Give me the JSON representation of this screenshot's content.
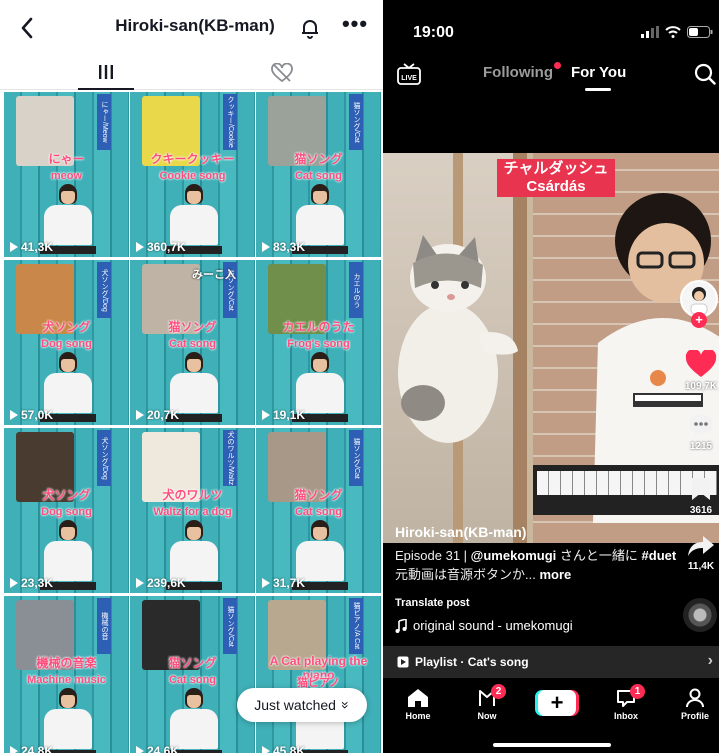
{
  "profile": {
    "title": "Hiroki-san(KB-man)",
    "back_glyph": "<",
    "more_glyph": "•••",
    "just_watched_label": "Just watched",
    "just_watched_chevron": "»",
    "videos": [
      {
        "label_jp": "にゃー",
        "label_en": "meow",
        "band": "にゃー/Meow",
        "views": "41,3K",
        "photo_color": "#d8d2c8"
      },
      {
        "label_jp": "クキークッキー",
        "label_en": "Cookie song",
        "band": "クッキー/Cookie song",
        "views": "360,7K",
        "photo_color": "#e9d84a"
      },
      {
        "label_jp": "猫ソング",
        "label_en": "Cat song",
        "band": "猫ソング/Cat song",
        "views": "83,3K",
        "photo_color": "#9aa29a"
      },
      {
        "label_jp": "犬ソング",
        "label_en": "Dog song",
        "band": "犬ソング/Dog song",
        "views": "57,0K",
        "photo_color": "#c9884a"
      },
      {
        "label_jp": "猫ソング",
        "label_en": "Cat song",
        "band": "猫ソング/Cat song",
        "views": "20,7K",
        "photo_color": "#bfb3a6",
        "top_text": "みーこ入"
      },
      {
        "label_jp": "カエルのうた",
        "label_en": "Frog's song",
        "band": "カエルのうた/Frog's song",
        "views": "19,1K",
        "photo_color": "#6f8f4a"
      },
      {
        "label_jp": "犬ソング",
        "label_en": "Dog song",
        "band": "犬ソング/Dog song",
        "views": "23,3K",
        "photo_color": "#4a3b30"
      },
      {
        "label_jp": "犬のワルツ",
        "label_en": "Waltz for a dog",
        "band": "犬のワルツ/Waltz for a dog",
        "views": "239,6K",
        "photo_color": "#efe8dc"
      },
      {
        "label_jp": "猫ソング",
        "label_en": "Cat song",
        "band": "猫ソング/Cat song",
        "views": "31,7K",
        "photo_color": "#a89888"
      },
      {
        "label_jp": "機械の音楽",
        "label_en": "Machine music",
        "band": "機械の音楽/Machine music",
        "views": "24,8K",
        "photo_color": "#8a8f96"
      },
      {
        "label_jp": "猫ソング",
        "label_en": "Cat song",
        "band": "猫ソング/Cat song",
        "views": "24,6K",
        "photo_color": "#2a2a2a"
      },
      {
        "label_jp": "A Cat playing the piano",
        "label_en": "猫ピアノ",
        "band": "猫ピアノ/A Cat playing the piano",
        "views": "45,8K",
        "photo_color": "#b8a890"
      }
    ]
  },
  "feed": {
    "status_time": "19:00",
    "tab_following": "Following",
    "tab_foryou": "For You",
    "live_label": "LIVE",
    "video_label_jp": "チャルダッシュ",
    "video_label_en": "Csárdás",
    "likes": "109,7K",
    "comments": "1215",
    "saves": "3616",
    "shares": "11,4K",
    "username": "Hiroki-san(KB-man)",
    "caption_prefix": "Episode 31 | ",
    "caption_mention": "@umekomugi",
    "caption_mid": " さんと一緒に ",
    "caption_hashtag": "#duet",
    "caption_rest": " 元動画は音源ボタンか...",
    "caption_more": " more",
    "translate": "Translate post",
    "sound": "original sound - umekomugi",
    "playlist": "Playlist · Cat's song",
    "nav": {
      "home": "Home",
      "now": "Now",
      "now_badge": "2",
      "inbox": "Inbox",
      "inbox_badge": "1",
      "profile": "Profile",
      "plus": "+"
    }
  },
  "colors": {
    "accent": "#fe2c55",
    "cyan": "#25f4ee",
    "grid_bg": "#3aa8b0",
    "pink_text": "#ff4d7d"
  }
}
